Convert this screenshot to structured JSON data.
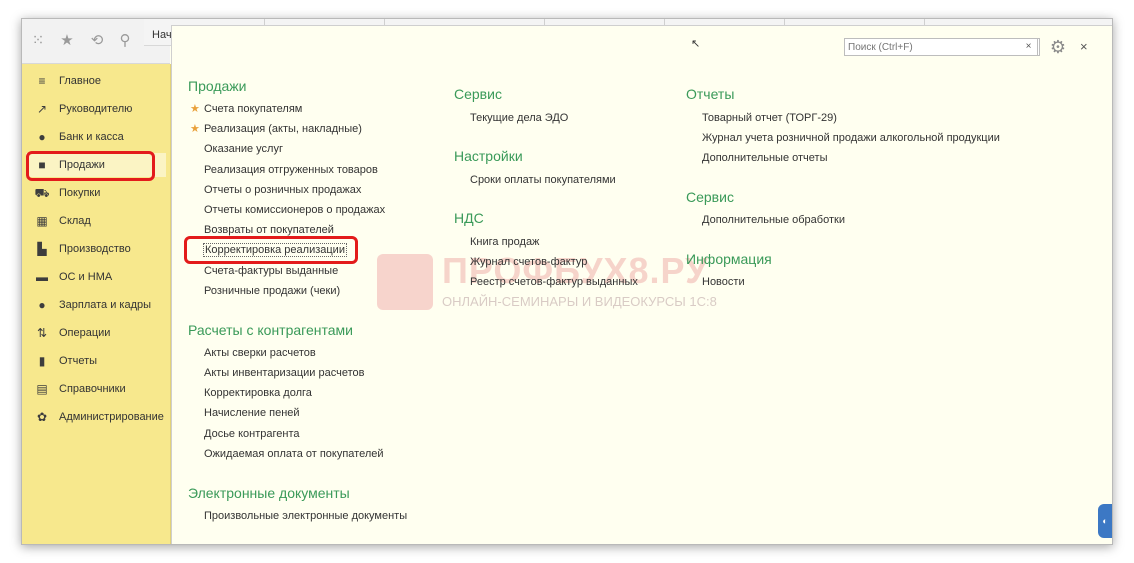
{
  "toolbar": {
    "tab_start": "Нач"
  },
  "sidebar": {
    "items": [
      {
        "label": "Главное",
        "icon": "menu-icon",
        "glyph": "≡"
      },
      {
        "label": "Руководителю",
        "icon": "chart-line-icon",
        "glyph": "↗"
      },
      {
        "label": "Банк и касса",
        "icon": "coin-icon",
        "glyph": "●"
      },
      {
        "label": "Продажи",
        "icon": "bag-icon",
        "glyph": "■"
      },
      {
        "label": "Покупки",
        "icon": "cart-icon",
        "glyph": "⛟"
      },
      {
        "label": "Склад",
        "icon": "warehouse-icon",
        "glyph": "▦"
      },
      {
        "label": "Производство",
        "icon": "factory-icon",
        "glyph": "▙"
      },
      {
        "label": "ОС и НМА",
        "icon": "truck-icon",
        "glyph": "▬"
      },
      {
        "label": "Зарплата и кадры",
        "icon": "person-icon",
        "glyph": "●"
      },
      {
        "label": "Операции",
        "icon": "operations-icon",
        "glyph": "⇅"
      },
      {
        "label": "Отчеты",
        "icon": "bar-chart-icon",
        "glyph": "▮"
      },
      {
        "label": "Справочники",
        "icon": "book-icon",
        "glyph": "▤"
      },
      {
        "label": "Администрирование",
        "icon": "gear-icon",
        "glyph": "✿"
      }
    ]
  },
  "search": {
    "placeholder": "Поиск (Ctrl+F)",
    "clear_label": "×"
  },
  "panel": {
    "close_label": "×",
    "col1": {
      "sales_head": "Продажи",
      "sales": [
        "Счета покупателям",
        "Реализация (акты, накладные)",
        "Оказание услуг",
        "Реализация отгруженных товаров",
        "Отчеты о розничных продажах",
        "Отчеты комиссионеров о продажах",
        "Возвраты от покупателей",
        "Корректировка реализации",
        "Счета-фактуры выданные",
        "Розничные продажи (чеки)"
      ],
      "settlements_head": "Расчеты с контрагентами",
      "settlements": [
        "Акты сверки расчетов",
        "Акты инвентаризации расчетов",
        "Корректировка долга",
        "Начисление пеней",
        "Досье контрагента",
        "Ожидаемая оплата от покупателей"
      ],
      "edoc_head": "Электронные документы",
      "edoc": [
        "Произвольные электронные документы"
      ]
    },
    "col2": {
      "service_head": "Сервис",
      "service": [
        "Текущие дела ЭДО"
      ],
      "settings_head": "Настройки",
      "settings": [
        "Сроки оплаты покупателями"
      ],
      "vat_head": "НДС",
      "vat": [
        "Книга продаж",
        "Журнал счетов-фактур",
        "Реестр счетов-фактур выданных"
      ]
    },
    "col3": {
      "reports_head": "Отчеты",
      "reports": [
        "Товарный отчет (ТОРГ-29)",
        "Журнал учета розничной продажи алкогольной продукции",
        "Дополнительные отчеты"
      ],
      "service_head": "Сервис",
      "service": [
        "Дополнительные обработки"
      ],
      "info_head": "Информация",
      "info": [
        "Новости"
      ]
    }
  },
  "watermark": {
    "title": "ПРОФБУХ8.РУ",
    "subtitle": "ОНЛАЙН-СЕМИНАРЫ И ВИДЕОКУРСЫ 1С:8"
  },
  "colors": {
    "sidebar_bg": "#f7e88d",
    "section_green": "#3a9a59",
    "highlight_red": "#e31b1b",
    "star_orange": "#e9a13b"
  }
}
